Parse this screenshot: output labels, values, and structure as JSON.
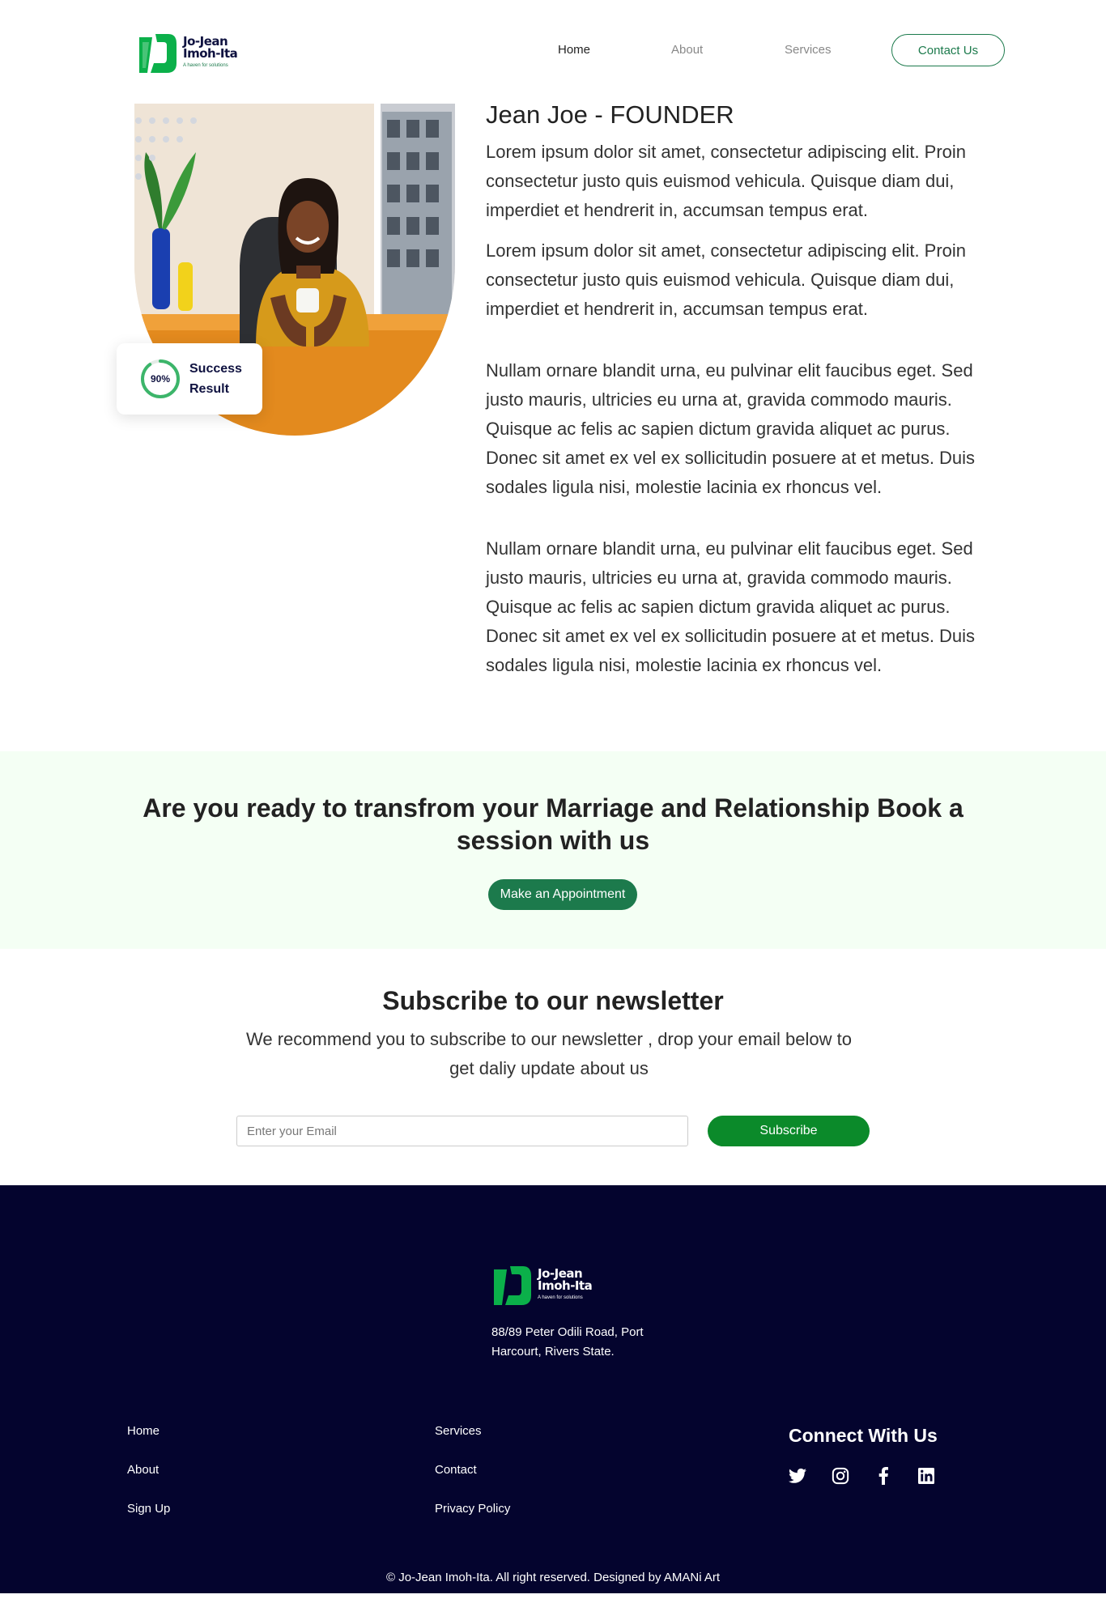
{
  "brand": {
    "name_line1": "Jo-Jean",
    "name_line2": "Imoh-Ita",
    "tagline": "A haven for solutions",
    "green": "#1c7a4c",
    "navy": "#04042e"
  },
  "nav": {
    "items": [
      "Home",
      "About",
      "Services"
    ],
    "active": "Home",
    "contact_label": "Contact Us"
  },
  "founder": {
    "title": "Jean Joe - FOUNDER",
    "paragraphs": [
      "Lorem ipsum dolor sit amet, consectetur adipiscing elit. Proin consectetur justo quis euismod vehicula. Quisque diam dui, imperdiet et hendrerit in, accumsan tempus erat.",
      "Lorem ipsum dolor sit amet, consectetur adipiscing elit. Proin consectetur justo quis euismod vehicula. Quisque diam dui, imperdiet et hendrerit in, accumsan tempus erat.",
      "Nullam ornare blandit urna, eu pulvinar elit faucibus eget. Sed justo mauris, ultricies eu urna at, gravida commodo mauris. Quisque ac felis ac sapien dictum gravida aliquet ac purus. Donec sit amet ex vel ex sollicitudin posuere at et metus. Duis sodales ligula nisi, molestie lacinia ex rhoncus vel.",
      "Nullam ornare blandit urna, eu pulvinar elit faucibus eget. Sed justo mauris, ultricies eu urna at, gravida commodo mauris. Quisque ac felis ac sapien dictum gravida aliquet ac purus. Donec sit amet ex vel ex sollicitudin posuere at et metus. Duis sodales ligula nisi, molestie lacinia ex rhoncus vel."
    ],
    "badge": {
      "percent_label": "90%",
      "progress": 0.9,
      "line1": "Success",
      "line2": "Result"
    }
  },
  "cta": {
    "title": "Are you ready to transfrom your Marriage and Relationship Book a session with us",
    "button": "Make an Appointment"
  },
  "newsletter": {
    "title": "Subscribe to our newsletter",
    "description": "We recommend you to subscribe to our newsletter , drop your email below to get daliy update about us",
    "placeholder": "Enter your Email",
    "button": "Subscribe"
  },
  "footer": {
    "address": "88/89 Peter Odili Road, Port Harcourt, Rivers State.",
    "col1": [
      "Home",
      "About",
      "Sign Up"
    ],
    "col2": [
      "Services",
      "Contact",
      "Privacy Policy"
    ],
    "connect_title": "Connect With Us",
    "socials": [
      "twitter-icon",
      "instagram-icon",
      "facebook-icon",
      "linkedin-icon"
    ],
    "copyright": "© Jo-Jean Imoh-Ita. All right reserved. Designed by AMANi Art"
  }
}
